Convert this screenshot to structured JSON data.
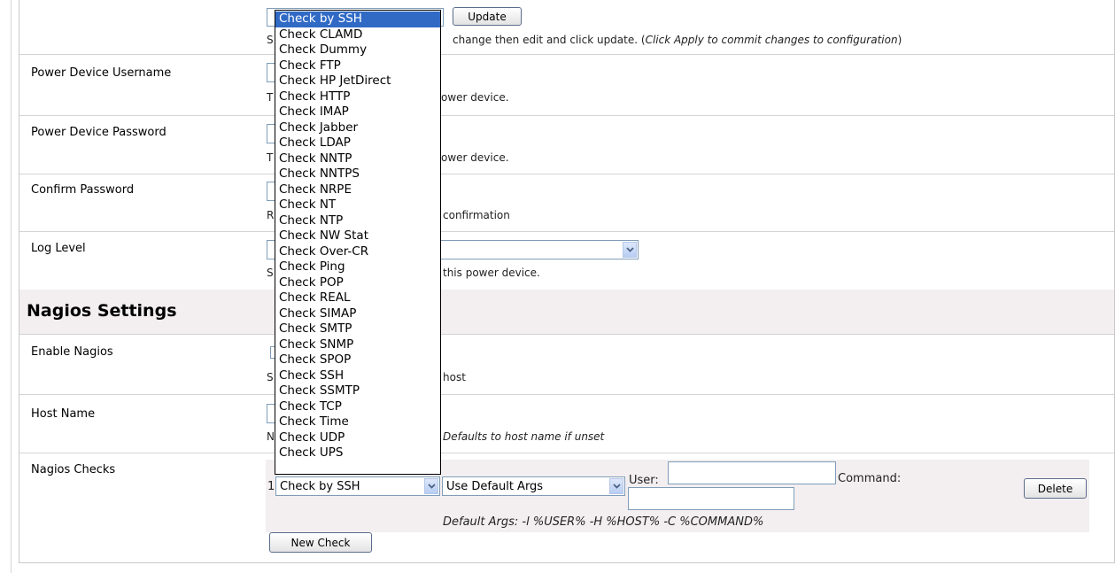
{
  "top_row": {
    "update_label": "Update",
    "help_prefix": "S",
    "help_text": "change then edit and click update. (",
    "help_italic": "Click Apply to commit changes to configuration",
    "help_suffix": ")"
  },
  "fields": {
    "username_label": "Power Device Username",
    "username_help_prefix": "T",
    "username_help": "ower device.",
    "password_label": "Power Device Password",
    "password_help_prefix": "T",
    "password_help": "ower device.",
    "confirm_label": "Confirm Password",
    "confirm_help_prefix": "R",
    "confirm_help": "confirmation",
    "loglevel_label": "Log Level",
    "loglevel_help_prefix": "S",
    "loglevel_help": "this power device."
  },
  "nagios": {
    "section_title": "Nagios Settings",
    "enable_label": "Enable Nagios",
    "enable_help_prefix": "S",
    "enable_help": "host",
    "hostname_label": "Host Name",
    "hostname_help_prefix": "N",
    "hostname_help": "Defaults to host name if unset",
    "checks_label": "Nagios Checks",
    "check_row": {
      "index": "1",
      "check_value": "Check by SSH",
      "args_value": "Use Default Args",
      "user_label": "User:",
      "user_value": "",
      "command_label": "Command:",
      "command_value": "",
      "delete_label": "Delete",
      "default_args": "Default Args: -l %USER% -H %HOST% -C %COMMAND%"
    },
    "new_check_label": "New Check"
  },
  "dropdown": {
    "selected": "Check by SSH",
    "options": [
      "Check by SSH",
      "Check CLAMD",
      "Check Dummy",
      "Check FTP",
      "Check HP JetDirect",
      "Check HTTP",
      "Check IMAP",
      "Check Jabber",
      "Check LDAP",
      "Check NNTP",
      "Check NNTPS",
      "Check NRPE",
      "Check NT",
      "Check NTP",
      "Check NW Stat",
      "Check Over-CR",
      "Check Ping",
      "Check POP",
      "Check REAL",
      "Check SIMAP",
      "Check SMTP",
      "Check SNMP",
      "Check SPOP",
      "Check SSH",
      "Check SSMTP",
      "Check TCP",
      "Check Time",
      "Check UDP",
      "Check UPS"
    ]
  },
  "icons": {
    "select_arrow": "chevron-down-icon"
  },
  "colors": {
    "section_bg": "#f3eef0",
    "selected_option": "#316ac5"
  }
}
